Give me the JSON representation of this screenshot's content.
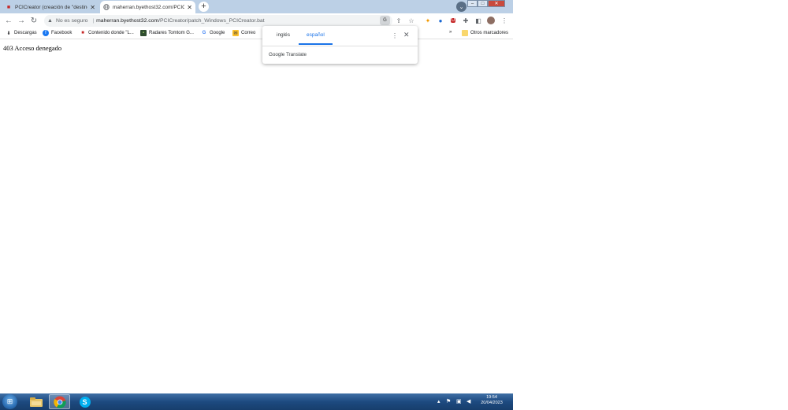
{
  "browser": {
    "tabs": [
      {
        "title": "PCICreator (creación de \"destino",
        "active": false,
        "icon": "red-flag-icon"
      },
      {
        "title": "maherran.byethost32.com/PCIC",
        "active": true,
        "icon": "globe-icon"
      }
    ],
    "address_bar": {
      "security_label": "No es seguro",
      "url_host": "maherran.byethost32.com",
      "url_path": "/PCICreator/patch_Windows_PCICreator.bat"
    },
    "bookmarks": [
      {
        "label": "Descargas",
        "icon": "download-icon"
      },
      {
        "label": "Facebook",
        "icon": "facebook-icon"
      },
      {
        "label": "Contenido donde \"L...",
        "icon": "bookmark-icon"
      },
      {
        "label": "Radares Tomtom G...",
        "icon": "radar-icon"
      },
      {
        "label": "Google",
        "icon": "google-icon"
      },
      {
        "label": "Correo",
        "icon": "mail-icon"
      }
    ],
    "other_bookmarks": "Otros marcadores",
    "overflow": "»"
  },
  "page": {
    "body_text": "403 Acceso denegado"
  },
  "translate_popup": {
    "lang_source": "inglés",
    "lang_target": "español",
    "brand": "Google Translate"
  },
  "taskbar": {
    "time": "19:54",
    "date": "20/04/2023"
  },
  "colors": {
    "accent": "#1a73e8",
    "tabstrip": "#bcd0e6",
    "taskbar": "#1d4a80"
  }
}
